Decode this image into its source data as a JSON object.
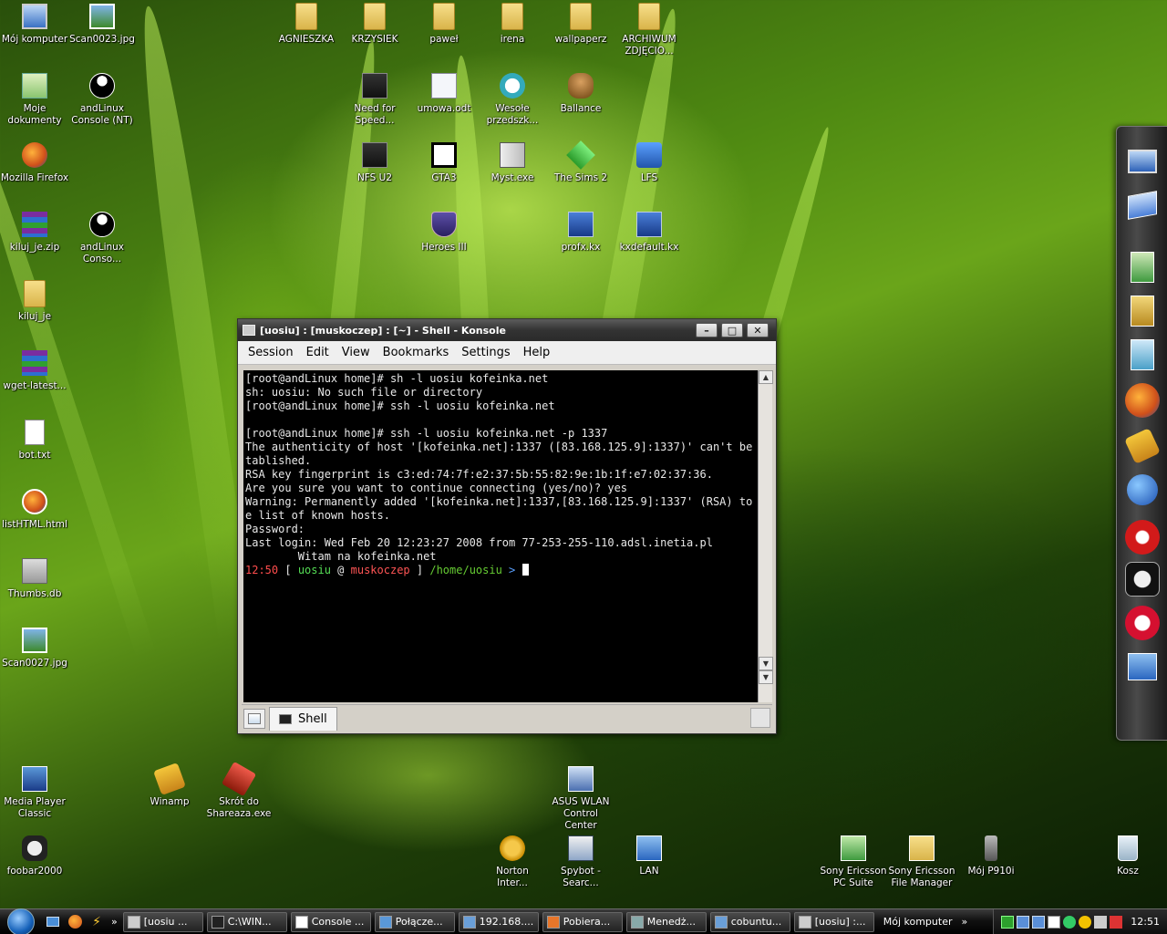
{
  "desktop": {
    "icons": [
      {
        "label": "Mój komputer",
        "icon": "my-computer-icon"
      },
      {
        "label": "Scan0023.jpg",
        "icon": "image-file-icon"
      },
      {
        "label": "AGNIESZKA",
        "icon": "folder-icon"
      },
      {
        "label": "KRZYSIEK",
        "icon": "folder-icon"
      },
      {
        "label": "paweł",
        "icon": "folder-icon"
      },
      {
        "label": "irena",
        "icon": "folder-icon"
      },
      {
        "label": "wallpaperz",
        "icon": "folder-icon"
      },
      {
        "label": "ARCHIWUM\nZDJĘCIO...",
        "icon": "folder-icon"
      },
      {
        "label": "Moje\ndokumenty",
        "icon": "my-documents-icon"
      },
      {
        "label": "andLinux\nConsole (NT)",
        "icon": "yin-yang-icon"
      },
      {
        "label": "Need for\nSpeed...",
        "icon": "nfs-game-icon"
      },
      {
        "label": "umowa.odt",
        "icon": "document-icon"
      },
      {
        "label": "Wesołe\nprzedszk...",
        "icon": "cartoon-face-icon"
      },
      {
        "label": "Ballance",
        "icon": "ballance-game-icon"
      },
      {
        "label": "Mozilla Firefox",
        "icon": "firefox-icon"
      },
      {
        "label": "NFS U2",
        "icon": "nfs-game-icon"
      },
      {
        "label": "GTA3",
        "icon": "gta-game-icon"
      },
      {
        "label": "Myst.exe",
        "icon": "book-icon"
      },
      {
        "label": "The Sims 2",
        "icon": "sims-plumbob-icon"
      },
      {
        "label": "LFS",
        "icon": "lfs-game-icon"
      },
      {
        "label": "kiluj_je.zip",
        "icon": "archive-icon"
      },
      {
        "label": "andLinux\nConso...",
        "icon": "yin-yang-icon"
      },
      {
        "label": "Heroes III",
        "icon": "heroes-shield-icon"
      },
      {
        "label": "profx.kx",
        "icon": "kx-file-icon"
      },
      {
        "label": "kxdefault.kx",
        "icon": "kx-file-icon"
      },
      {
        "label": "kiluj_je",
        "icon": "folder-icon"
      },
      {
        "label": "wget-latest...",
        "icon": "archive-icon"
      },
      {
        "label": "bot.txt",
        "icon": "text-file-icon"
      },
      {
        "label": "listHTML.html",
        "icon": "firefox-html-icon"
      },
      {
        "label": "Thumbs.db",
        "icon": "system-file-icon"
      },
      {
        "label": "Scan0027.jpg",
        "icon": "image-file-icon"
      },
      {
        "label": "Media Player\nClassic",
        "icon": "media-player-icon"
      },
      {
        "label": "Winamp",
        "icon": "winamp-icon"
      },
      {
        "label": "Skrót do\nShareaza.exe",
        "icon": "shareaza-icon"
      },
      {
        "label": "ASUS WLAN\nControl Center",
        "icon": "wlan-icon"
      },
      {
        "label": "foobar2000",
        "icon": "foobar-icon"
      },
      {
        "label": "Norton\nInter...",
        "icon": "norton-icon"
      },
      {
        "label": "Spybot -\nSearc...",
        "icon": "spybot-icon"
      },
      {
        "label": "LAN",
        "icon": "network-icon"
      },
      {
        "label": "Sony Ericsson\nPC Suite",
        "icon": "pc-suite-icon"
      },
      {
        "label": "Sony Ericsson\nFile Manager",
        "icon": "file-manager-icon"
      },
      {
        "label": "Mój P910i",
        "icon": "phone-icon"
      },
      {
        "label": "Kosz",
        "icon": "recycle-bin-icon"
      }
    ]
  },
  "dock": {
    "items": [
      "computer-icon",
      "window-icon",
      "documents-folder-icon",
      "books-folder-icon",
      "pictures-folder-icon",
      "firefox-icon",
      "winamp-icon",
      "earth-icon",
      "eraser-icon",
      "foobar-icon",
      "lastfm-icon",
      "network-settings-icon"
    ]
  },
  "konsole": {
    "title": "[uosiu] : [muskoczep] : [~] - Shell - Konsole",
    "menu": [
      "Session",
      "Edit",
      "View",
      "Bookmarks",
      "Settings",
      "Help"
    ],
    "lines": [
      "[root@andLinux home]# sh -l uosiu kofeinka.net",
      "sh: uosiu: No such file or directory",
      "[root@andLinux home]# ssh -l uosiu kofeinka.net",
      "",
      "[root@andLinux home]# ssh -l uosiu kofeinka.net -p 1337",
      "The authenticity of host '[kofeinka.net]:1337 ([83.168.125.9]:1337)' can't be es",
      "tablished.",
      "RSA key fingerprint is c3:ed:74:7f:e2:37:5b:55:82:9e:1b:1f:e7:02:37:36.",
      "Are you sure you want to continue connecting (yes/no)? yes",
      "Warning: Permanently added '[kofeinka.net]:1337,[83.168.125.9]:1337' (RSA) to th",
      "e list of known hosts.",
      "Password:",
      "Last login: Wed Feb 20 12:23:27 2008 from 77-253-255-110.adsl.inetia.pl",
      "        Witam na kofeinka.net"
    ],
    "prompt": {
      "time": "12:50",
      "open": " [ ",
      "user": "uosiu",
      "at": " @ ",
      "host": "muskoczep",
      "close": " ] ",
      "path": "/home/uosiu",
      "symbol": " > ",
      "colors": {
        "time": "#ff4d4d",
        "user": "#55dd55",
        "host": "#ff5555",
        "path": "#66cc33",
        "symbol": "#5aa0ff"
      }
    },
    "tab_label": "Shell"
  },
  "taskbar": {
    "buttons": [
      "[uosiu ...",
      "C:\\WIN...",
      "Console ...",
      "Połącze...",
      "192.168....",
      "Pobiera...",
      "Menedż...",
      "cobuntu...",
      "[uosiu] :..."
    ],
    "button_icons": [
      "konsole-icon",
      "cmd-icon",
      "yin-yang-icon",
      "network-icon",
      "putty-icon",
      "firefox-icon",
      "task-manager-icon",
      "putty-icon",
      "konsole-icon"
    ],
    "address_text": "Mój komputer",
    "more": "»",
    "clock": "12:51"
  }
}
